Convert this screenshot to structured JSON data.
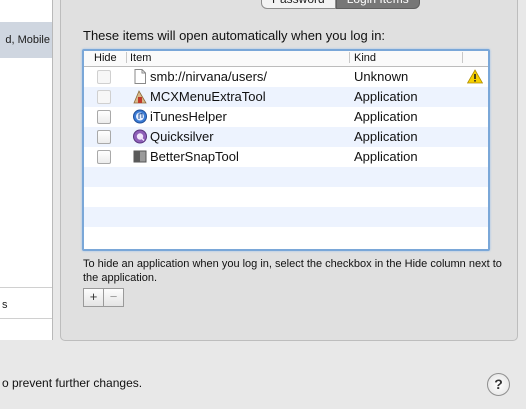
{
  "sidebar": {
    "selected_label": "d, Mobile",
    "bottom_label": "s"
  },
  "tabs": [
    {
      "label": "Password",
      "active": false
    },
    {
      "label": "Login Items",
      "active": true
    }
  ],
  "intro": "These items will open automatically when you log in:",
  "table": {
    "columns": {
      "hide": "Hide",
      "item": "Item",
      "kind": "Kind"
    },
    "rows": [
      {
        "name": "smb://nirvana/users/",
        "kind": "Unknown",
        "icon": "document-icon",
        "hide_enabled": false,
        "warning": true
      },
      {
        "name": "MCXMenuExtraTool",
        "kind": "Application",
        "icon": "app-icon",
        "hide_enabled": false,
        "warning": false
      },
      {
        "name": "iTunesHelper",
        "kind": "Application",
        "icon": "itunes-icon",
        "hide_enabled": true,
        "warning": false
      },
      {
        "name": "Quicksilver",
        "kind": "Application",
        "icon": "quicksilver-icon",
        "hide_enabled": true,
        "warning": false
      },
      {
        "name": "BetterSnapTool",
        "kind": "Application",
        "icon": "bettersnaptool-icon",
        "hide_enabled": true,
        "warning": false
      }
    ]
  },
  "help_text": "To hide an application when you log in, select the checkbox in the Hide column next to the application.",
  "buttons": {
    "add": "+",
    "remove": "−"
  },
  "lock_text": "o prevent further changes.",
  "help_button": "?"
}
